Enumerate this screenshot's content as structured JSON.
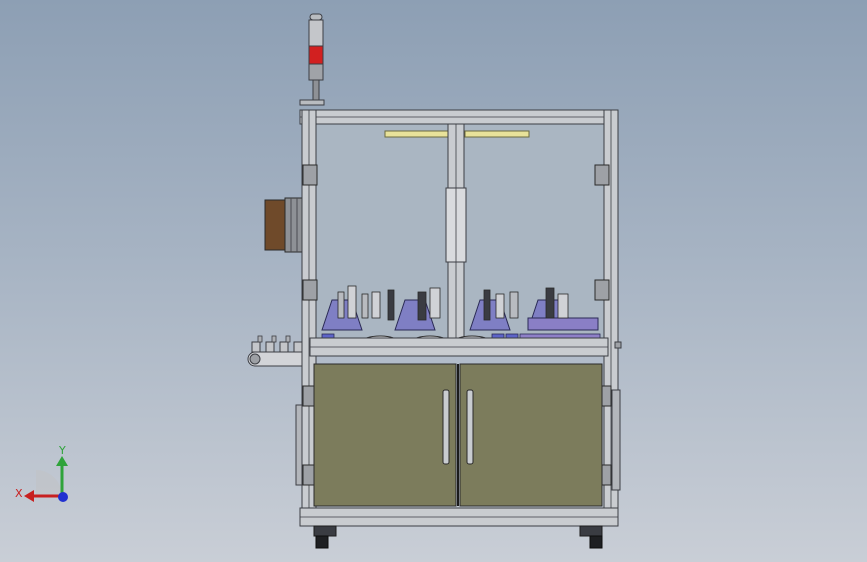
{
  "triad": {
    "y_label": "Y",
    "x_label": "X",
    "colors": {
      "y": "#2fa33a",
      "x": "#c82020",
      "z": "#2030d0"
    }
  },
  "colors": {
    "frame": "#c9ccd0",
    "frame_edge": "#3c3e44",
    "cabinet_panel": "#7c7c5c",
    "glass": "#aab6c2",
    "fixture_blue": "#7f7fc4",
    "light_tower_red": "#d22020",
    "gearbox_brown": "#6f4a2a",
    "lamp_yellow": "#e8e29a"
  },
  "parts": [
    "light-tower",
    "machine-frame",
    "upper-enclosure",
    "lower-cabinet",
    "conveyor",
    "side-motor",
    "casters"
  ]
}
